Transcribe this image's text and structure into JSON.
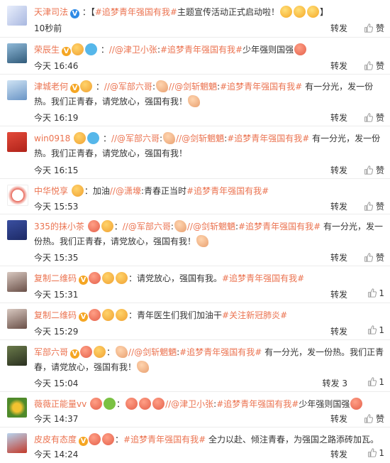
{
  "comments": [
    {
      "name": "天津司法",
      "prefix": "：【",
      "topic": "#追梦青年强国有我#",
      "text": "主题宣传活动正式启动啦！",
      "suffix": "】",
      "time": "10秒前",
      "repost": "转发",
      "likes": "赞"
    },
    {
      "name": "荣辰生",
      "mention": "//@津卫小张",
      "topic": "#追梦青年强国有我#",
      "text": "少年强则国强",
      "time": "今天 16:46",
      "repost": "转发",
      "likes": "赞"
    },
    {
      "name": "津城老何",
      "mention1": "//@军部六哥",
      "mention2": "//@剑斩魍魉",
      "topic": "#追梦青年强国有我#",
      "text": " 有一分光，发一份热。我们正青春，请党放心，强国有我！",
      "time": "今天 16:19",
      "repost": "转发",
      "likes": "赞"
    },
    {
      "name": "win0918",
      "mention1": "//@军部六哥",
      "mention2": "//@剑斩魍魉",
      "topic": "#追梦青年强国有我#",
      "text": " 有一分光，发一份热。我们正青春，请党放心，强国有我！",
      "time": "今天 16:15",
      "repost": "转发",
      "likes": "赞"
    },
    {
      "name": "中华悦享",
      "prefix": "：加油",
      "mention": "//@潇壕",
      "text": "青春正当时",
      "topic": "#追梦青年强国有我#",
      "time": "今天 15:53",
      "repost": "转发",
      "likes": "赞"
    },
    {
      "name": "335的抹小茶",
      "mention1": "//@军部六哥",
      "mention2": "//@剑斩魍魉",
      "topic": "#追梦青年强国有我#",
      "text": " 有一分光，发一份热。我们正青春，请党放心，强国有我！",
      "time": "今天 15:35",
      "repost": "转发",
      "likes": "赞"
    },
    {
      "name": "复制二维码",
      "text": "：请党放心，强国有我。",
      "topic": "#追梦青年强国有我#",
      "time": "今天 15:31",
      "repost": "转发",
      "likes": "1"
    },
    {
      "name": "复制二维码",
      "text": "：青年医生们我们加油干",
      "topic": "#关注新冠肺炎#",
      "time": "今天 15:29",
      "repost": "转发",
      "likes": "1"
    },
    {
      "name": "军部六哥",
      "mention": "//@剑斩魍魉",
      "topic": "#追梦青年强国有我#",
      "text": " 有一分光，发一份热。我们正青春，请党放心，强国有我！",
      "time": "今天 15:04",
      "repost": "转发 3",
      "likes": "1"
    },
    {
      "name": "薇薇正能量vv",
      "mention": "//@津卫小张",
      "topic": "#追梦青年强国有我#",
      "text": "少年强则国强",
      "time": "今天 14:37",
      "repost": "转发",
      "likes": "赞"
    },
    {
      "name": "皮皮有态度",
      "topic": "#追梦青年强国有我#",
      "text": " 全力以赴、倾注青春，为强国之路添砖加瓦。",
      "time": "今天 14:24",
      "repost": "转发",
      "likes": "1"
    }
  ]
}
